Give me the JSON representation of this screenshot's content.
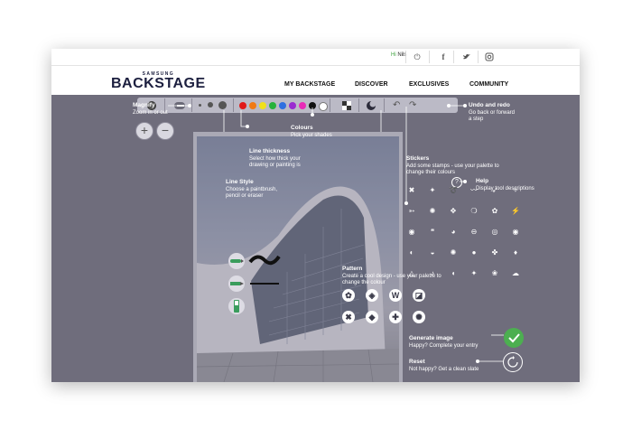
{
  "topbar": {
    "greeting_hi": "Hi",
    "greeting_name": "Nils",
    "icons": [
      "power-icon",
      "facebook-icon",
      "twitter-icon",
      "instagram-icon"
    ]
  },
  "logo": {
    "brand": "SAMSUNG",
    "name": "BACKSTAGE"
  },
  "nav": [
    "MY BACKSTAGE",
    "DISCOVER",
    "EXCLUSIVES",
    "COMMUNITY"
  ],
  "colours": [
    "#e01818",
    "#f07a14",
    "#f0e01a",
    "#27b23b",
    "#2f6fe0",
    "#9a2bd0",
    "#e82ab7",
    "#111111",
    "#ffffff"
  ],
  "help": {
    "magnify": {
      "title": "Magnify",
      "desc": "Zoom in or out"
    },
    "undo": {
      "title": "Undo and redo",
      "desc1": "Go back or forward",
      "desc2": "a step"
    },
    "help": {
      "title": "Help",
      "desc": "Display tool descriptions"
    },
    "line_thickness": {
      "title": "Line thickness",
      "desc1": "Select how thick your",
      "desc2": "drawing or painting is"
    },
    "colours": {
      "title": "Colours",
      "desc": "Pick your shades"
    },
    "stickers": {
      "title": "Stickers",
      "desc1": "Add some stamps - use your palette to",
      "desc2": "change their colours"
    },
    "line_style": {
      "title": "Line Style",
      "desc1": "Choose a paintbrush,",
      "desc2": "pencil or eraser"
    },
    "pattern": {
      "title": "Pattern",
      "desc1": "Create a cool design - use your palette to",
      "desc2": "change the colour"
    },
    "generate": {
      "title": "Generate image",
      "desc": "Happy? Complete your entry"
    },
    "reset": {
      "title": "Reset",
      "desc": "Not happy? Get a clean slate"
    }
  },
  "help_button": "?",
  "zoom_in": "+",
  "zoom_out": "−",
  "accent_green": "#4caf50"
}
